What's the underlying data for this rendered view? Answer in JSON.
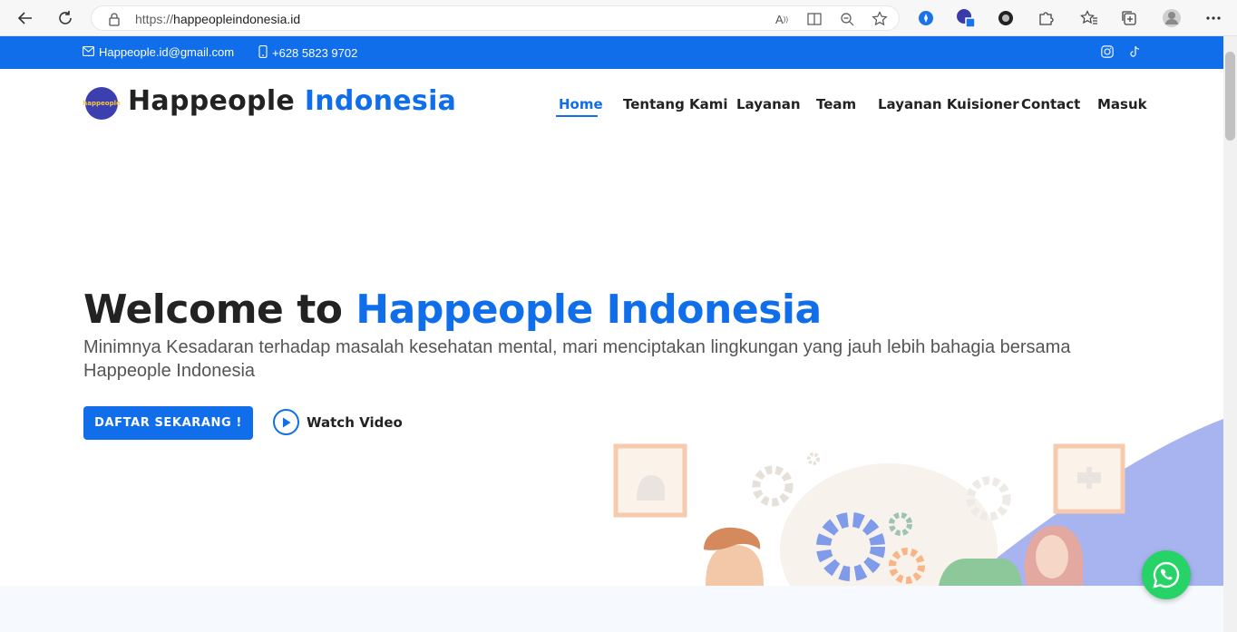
{
  "browser": {
    "url_protocol": "https://",
    "url_domain": "happeopleindonesia.id"
  },
  "topbar": {
    "email": "Happeople.id@gmail.com",
    "phone": "+628 5823 9702",
    "social_icons": [
      "instagram-icon",
      "tiktok-icon"
    ]
  },
  "header": {
    "logo_badge": "happeople",
    "brand_part1": "Happeople",
    "brand_part2": "Indonesia",
    "nav": [
      {
        "label": "Home",
        "active": true
      },
      {
        "label": "Tentang Kami"
      },
      {
        "label": "Layanan"
      },
      {
        "label": "Team"
      },
      {
        "label": "Layanan Kuisioner"
      },
      {
        "label": "Contact"
      },
      {
        "label": "Masuk"
      }
    ]
  },
  "hero": {
    "title_part1": "Welcome to",
    "title_part2": "Happeople Indonesia",
    "subtitle": "Minimnya Kesadaran terhadap masalah kesehatan mental, mari menciptakan lingkungan yang jauh lebih bahagia bersama Happeople Indonesia",
    "cta_label": "DAFTAR SEKARANG !",
    "watch_label": "Watch Video"
  },
  "colors": {
    "brand_blue": "#106eea",
    "whatsapp_green": "#25d366"
  }
}
